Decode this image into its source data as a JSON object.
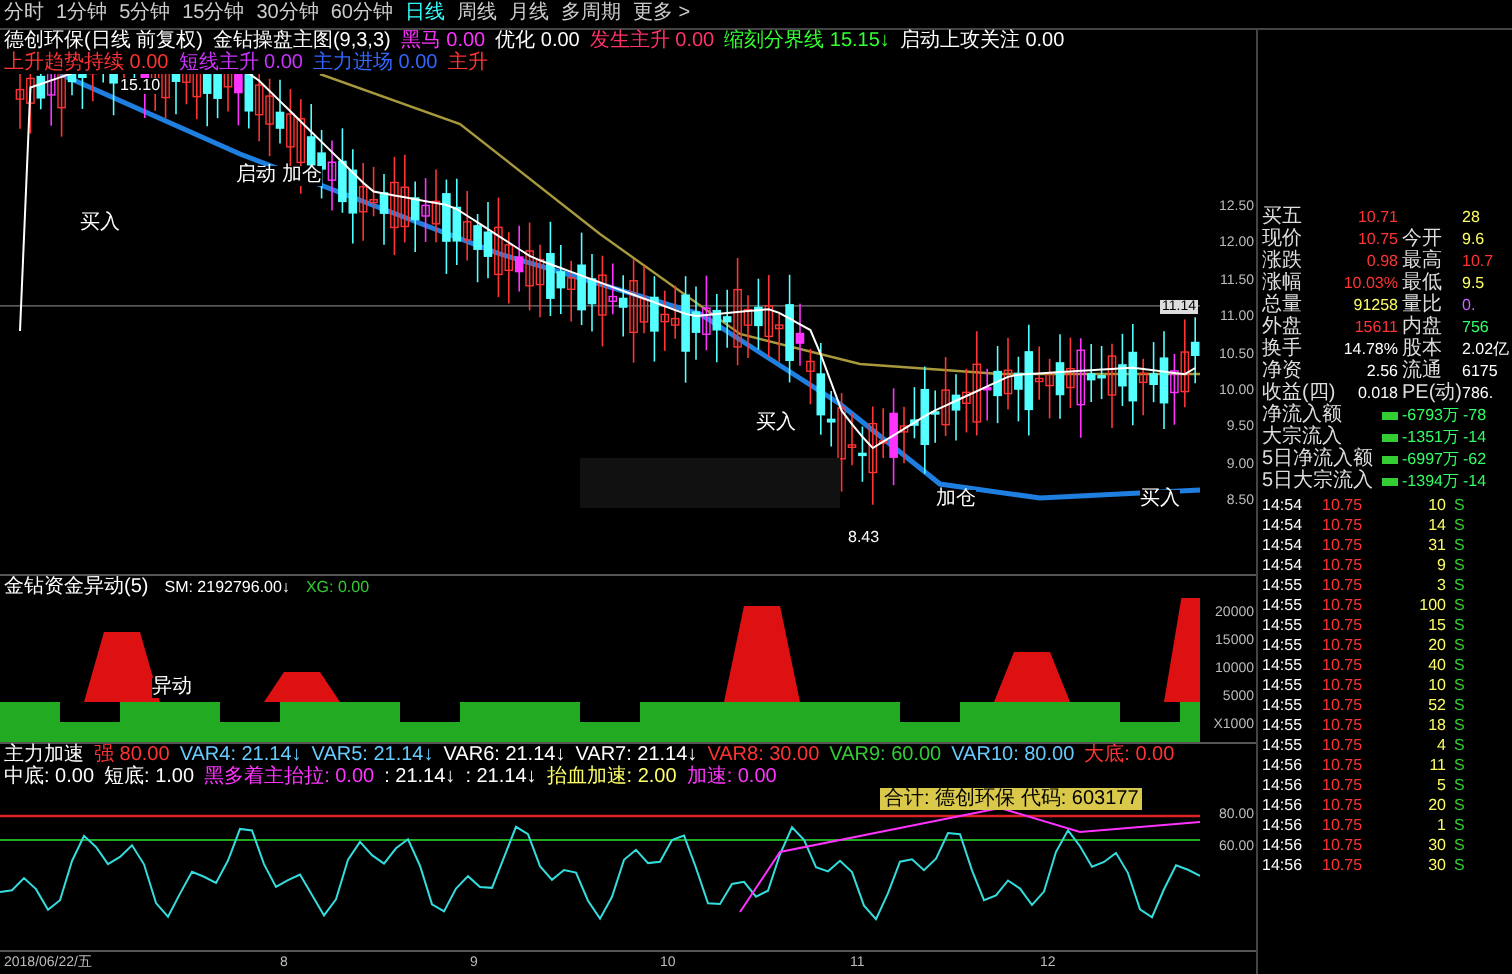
{
  "period_tabs": [
    {
      "label": "分时",
      "selected": false
    },
    {
      "label": "1分钟",
      "selected": false
    },
    {
      "label": "5分钟",
      "selected": false
    },
    {
      "label": "15分钟",
      "selected": false
    },
    {
      "label": "30分钟",
      "selected": false
    },
    {
      "label": "60分钟",
      "selected": false
    },
    {
      "label": "日线",
      "selected": true
    },
    {
      "label": "周线",
      "selected": false
    },
    {
      "label": "月线",
      "selected": false
    },
    {
      "label": "多周期",
      "selected": false
    },
    {
      "label": "更多 >",
      "selected": false
    }
  ],
  "chart_header": {
    "title": "德创环保(日线 前复权)",
    "indicator": "金钻操盘主图(9,3,3)",
    "readings": [
      {
        "text": "黑马 0.00",
        "color": "#ff33ff"
      },
      {
        "text": "优化 0.00",
        "color": "#ffffff"
      },
      {
        "text": "发生主升 0.00",
        "color": "#ff3366"
      },
      {
        "text": "缩刻分界线 15.15↓",
        "color": "#33ff33"
      },
      {
        "text": "启动上攻关注 0.00",
        "color": "#ffffff"
      },
      {
        "text": "上升趋势持续 0.00",
        "color": "#ff3333"
      },
      {
        "text": "短线主升 0.00",
        "color": "#cc33ff"
      },
      {
        "text": "主力进场 0.00",
        "color": "#3366ff"
      },
      {
        "text": "主升",
        "color": "#ff3333"
      }
    ]
  },
  "main_chart": {
    "high_label": "15.10",
    "low_label": "8.43",
    "current_price": "11.14",
    "price_labels": [
      "12.50",
      "12.00",
      "11.50",
      "11.00",
      "10.50",
      "10.00",
      "9.50",
      "9.00",
      "8.50"
    ],
    "signals": [
      "买入",
      "启动 加仓",
      "买入",
      "加仓",
      "买入"
    ]
  },
  "quote": [
    {
      "cells": [
        {
          "label": "买五",
          "value": "10.71",
          "color": "#ff3333"
        },
        {
          "value": "28",
          "color": "#ffff66"
        }
      ]
    },
    {
      "cells": [
        {
          "label": "现价",
          "value": "10.75",
          "color": "#ff3333"
        },
        {
          "label": "今开",
          "value": "9.6",
          "color": "#ffff66"
        }
      ]
    },
    {
      "cells": [
        {
          "label": "涨跌",
          "value": "0.98",
          "color": "#ff3333"
        },
        {
          "label": "最高",
          "value": "10.7",
          "color": "#ff3333"
        }
      ]
    },
    {
      "cells": [
        {
          "label": "涨幅",
          "value": "10.03%",
          "color": "#ff3333"
        },
        {
          "label": "最低",
          "value": "9.5",
          "color": "#ffff66"
        }
      ]
    },
    {
      "cells": [
        {
          "label": "总量",
          "value": "91258",
          "color": "#ffff66"
        },
        {
          "label": "量比",
          "value": "0.",
          "color": "#cc66ff"
        }
      ]
    },
    {
      "cells": [
        {
          "label": "外盘",
          "value": "15611",
          "color": "#ff3333"
        },
        {
          "label": "内盘",
          "value": "756",
          "color": "#33ff66"
        }
      ]
    },
    {
      "cells": [
        {
          "label": "换手",
          "value": "14.78%",
          "color": "#ffffff"
        },
        {
          "label": "股本",
          "value": "2.02亿",
          "color": "#ffffff"
        }
      ]
    },
    {
      "cells": [
        {
          "label": "净资",
          "value": "2.56",
          "color": "#ffffff"
        },
        {
          "label": "流通",
          "value": "6175",
          "color": "#ffffff"
        }
      ]
    },
    {
      "cells": [
        {
          "label": "收益(四)",
          "value": "0.018",
          "color": "#ffffff"
        },
        {
          "label": "PE(动)",
          "value": "786.",
          "color": "#ffffff"
        }
      ]
    }
  ],
  "money_flow": [
    {
      "label": "净流入额",
      "value": "-6793万",
      "value2": "-78",
      "color": "#33cc33"
    },
    {
      "label": "大宗流入",
      "value": "-1351万",
      "value2": "-14",
      "color": "#33cc33"
    },
    {
      "label": "5日净流入额",
      "value": "-6997万",
      "value2": "-62",
      "color": "#33cc33"
    },
    {
      "label": "5日大宗流入",
      "value": "-1394万",
      "value2": "-14",
      "color": "#33cc33"
    }
  ],
  "trades": [
    {
      "time": "14:54",
      "price": "10.75",
      "volume": "10",
      "side": "S"
    },
    {
      "time": "14:54",
      "price": "10.75",
      "volume": "14",
      "side": "S"
    },
    {
      "time": "14:54",
      "price": "10.75",
      "volume": "31",
      "side": "S"
    },
    {
      "time": "14:54",
      "price": "10.75",
      "volume": "9",
      "side": "S"
    },
    {
      "time": "14:55",
      "price": "10.75",
      "volume": "3",
      "side": "S"
    },
    {
      "time": "14:55",
      "price": "10.75",
      "volume": "100",
      "side": "S"
    },
    {
      "time": "14:55",
      "price": "10.75",
      "volume": "15",
      "side": "S"
    },
    {
      "time": "14:55",
      "price": "10.75",
      "volume": "20",
      "side": "S"
    },
    {
      "time": "14:55",
      "price": "10.75",
      "volume": "40",
      "side": "S"
    },
    {
      "time": "14:55",
      "price": "10.75",
      "volume": "10",
      "side": "S"
    },
    {
      "time": "14:55",
      "price": "10.75",
      "volume": "52",
      "side": "S"
    },
    {
      "time": "14:55",
      "price": "10.75",
      "volume": "18",
      "side": "S"
    },
    {
      "time": "14:55",
      "price": "10.75",
      "volume": "4",
      "side": "S"
    },
    {
      "time": "14:56",
      "price": "10.75",
      "volume": "11",
      "side": "S"
    },
    {
      "time": "14:56",
      "price": "10.75",
      "volume": "5",
      "side": "S"
    },
    {
      "time": "14:56",
      "price": "10.75",
      "volume": "20",
      "side": "S"
    },
    {
      "time": "14:56",
      "price": "10.75",
      "volume": "1",
      "side": "S"
    },
    {
      "time": "14:56",
      "price": "10.75",
      "volume": "30",
      "side": "S"
    },
    {
      "time": "14:56",
      "price": "10.75",
      "volume": "30",
      "side": "S"
    }
  ],
  "flow_indicator": {
    "title": "金钻资金异动(5)",
    "readings": [
      {
        "text": "SM: 2192796.00↓",
        "color": "#ffffff"
      },
      {
        "text": "XG: 0.00",
        "color": "#33cc33"
      }
    ],
    "axis_labels": [
      "20000",
      "15000",
      "10000",
      "5000",
      "X1000"
    ],
    "signal": "异动"
  },
  "speed_indicator": {
    "title": "主力加速",
    "readings": [
      {
        "text": "强 80.00",
        "color": "#ff3333"
      },
      {
        "text": "VAR4: 21.14↓",
        "color": "#66ccff"
      },
      {
        "text": "VAR5: 21.14↓",
        "color": "#66ccff"
      },
      {
        "text": "VAR6: 21.14↓",
        "color": "#ffffff"
      },
      {
        "text": "VAR7: 21.14↓",
        "color": "#ffffff"
      },
      {
        "text": "VAR8: 30.00",
        "color": "#ff3333"
      },
      {
        "text": "VAR9: 60.00",
        "color": "#33cc33"
      },
      {
        "text": "VAR10: 80.00",
        "color": "#66ccff"
      },
      {
        "text": "大底: 0.00",
        "color": "#ff3333"
      },
      {
        "text": "中底: 0.00",
        "color": "#ffffff"
      },
      {
        "text": "短底: 1.00",
        "color": "#ffffff"
      },
      {
        "text": "黑多着主抬拉: 0.00",
        "color": "#ff33ff"
      },
      {
        "text": ": 21.14↓",
        "color": "#ffffff"
      },
      {
        "text": ": 21.14↓",
        "color": "#ffffff"
      },
      {
        "text": "抬血加速: 2.00",
        "color": "#ffff66"
      },
      {
        "text": "加速: 0.00",
        "color": "#ff33ff"
      }
    ],
    "banner": "合计: 德创环保 代码: 603177",
    "axis_labels": [
      "80.00",
      "60.00"
    ]
  },
  "date_axis": [
    "2018/06/22/五",
    "8",
    "9",
    "10",
    "11",
    "12"
  ]
}
